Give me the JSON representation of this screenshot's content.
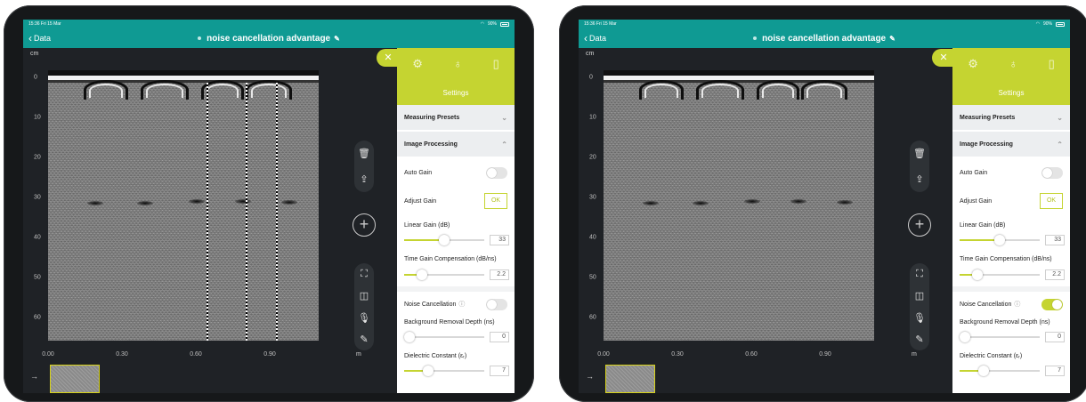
{
  "status": {
    "time": "15:36",
    "date": "Fri 15 Mar",
    "battery": "90%"
  },
  "nav": {
    "back_label": "Data",
    "title": "noise cancellation advantage"
  },
  "axis": {
    "y_unit": "cm",
    "y_ticks": [
      "0",
      "10",
      "20",
      "30",
      "40",
      "50",
      "60"
    ],
    "x_unit": "m",
    "x_ticks": [
      "0.00",
      "0.30",
      "0.60",
      "0.90"
    ]
  },
  "panel": {
    "title": "Settings",
    "measuring_presets": "Measuring Presets",
    "image_processing": "Image Processing",
    "auto_gain": "Auto Gain",
    "adjust_gain": "Adjust Gain",
    "ok_label": "OK",
    "linear_gain_label": "Linear Gain (dB)",
    "linear_gain_value": "33",
    "linear_gain_fraction": 0.5,
    "tgc_label": "Time Gain Compensation (dB/ns)",
    "tgc_value": "2.2",
    "tgc_fraction": 0.22,
    "noise_cancellation": "Noise Cancellation",
    "bg_removal_label": "Background Removal Depth (ns)",
    "bg_removal_value": "0",
    "bg_removal_fraction": 0.0,
    "dielectric_label": "Dielectric Constant (εᵣ)",
    "dielectric_value": "7",
    "dielectric_fraction": 0.3
  },
  "views": [
    {
      "id": "left",
      "noise_cancellation_on": false,
      "shows_noise_lines": true
    },
    {
      "id": "right",
      "noise_cancellation_on": true,
      "shows_noise_lines": false
    }
  ],
  "colors": {
    "accent": "#c5d431",
    "nav": "#0f9a93",
    "screen_bg": "#1f2226"
  },
  "icons": [
    "back-chevron-icon",
    "edit-pencil-icon",
    "close-icon",
    "gear-icon",
    "antenna-icon",
    "panel-layout-icon",
    "trash-icon",
    "share-icon",
    "add-icon",
    "crop-icon",
    "split-view-icon",
    "mic-icon",
    "marker-icon",
    "info-icon",
    "wifi-icon",
    "battery-icon",
    "arrow-right-icon"
  ]
}
